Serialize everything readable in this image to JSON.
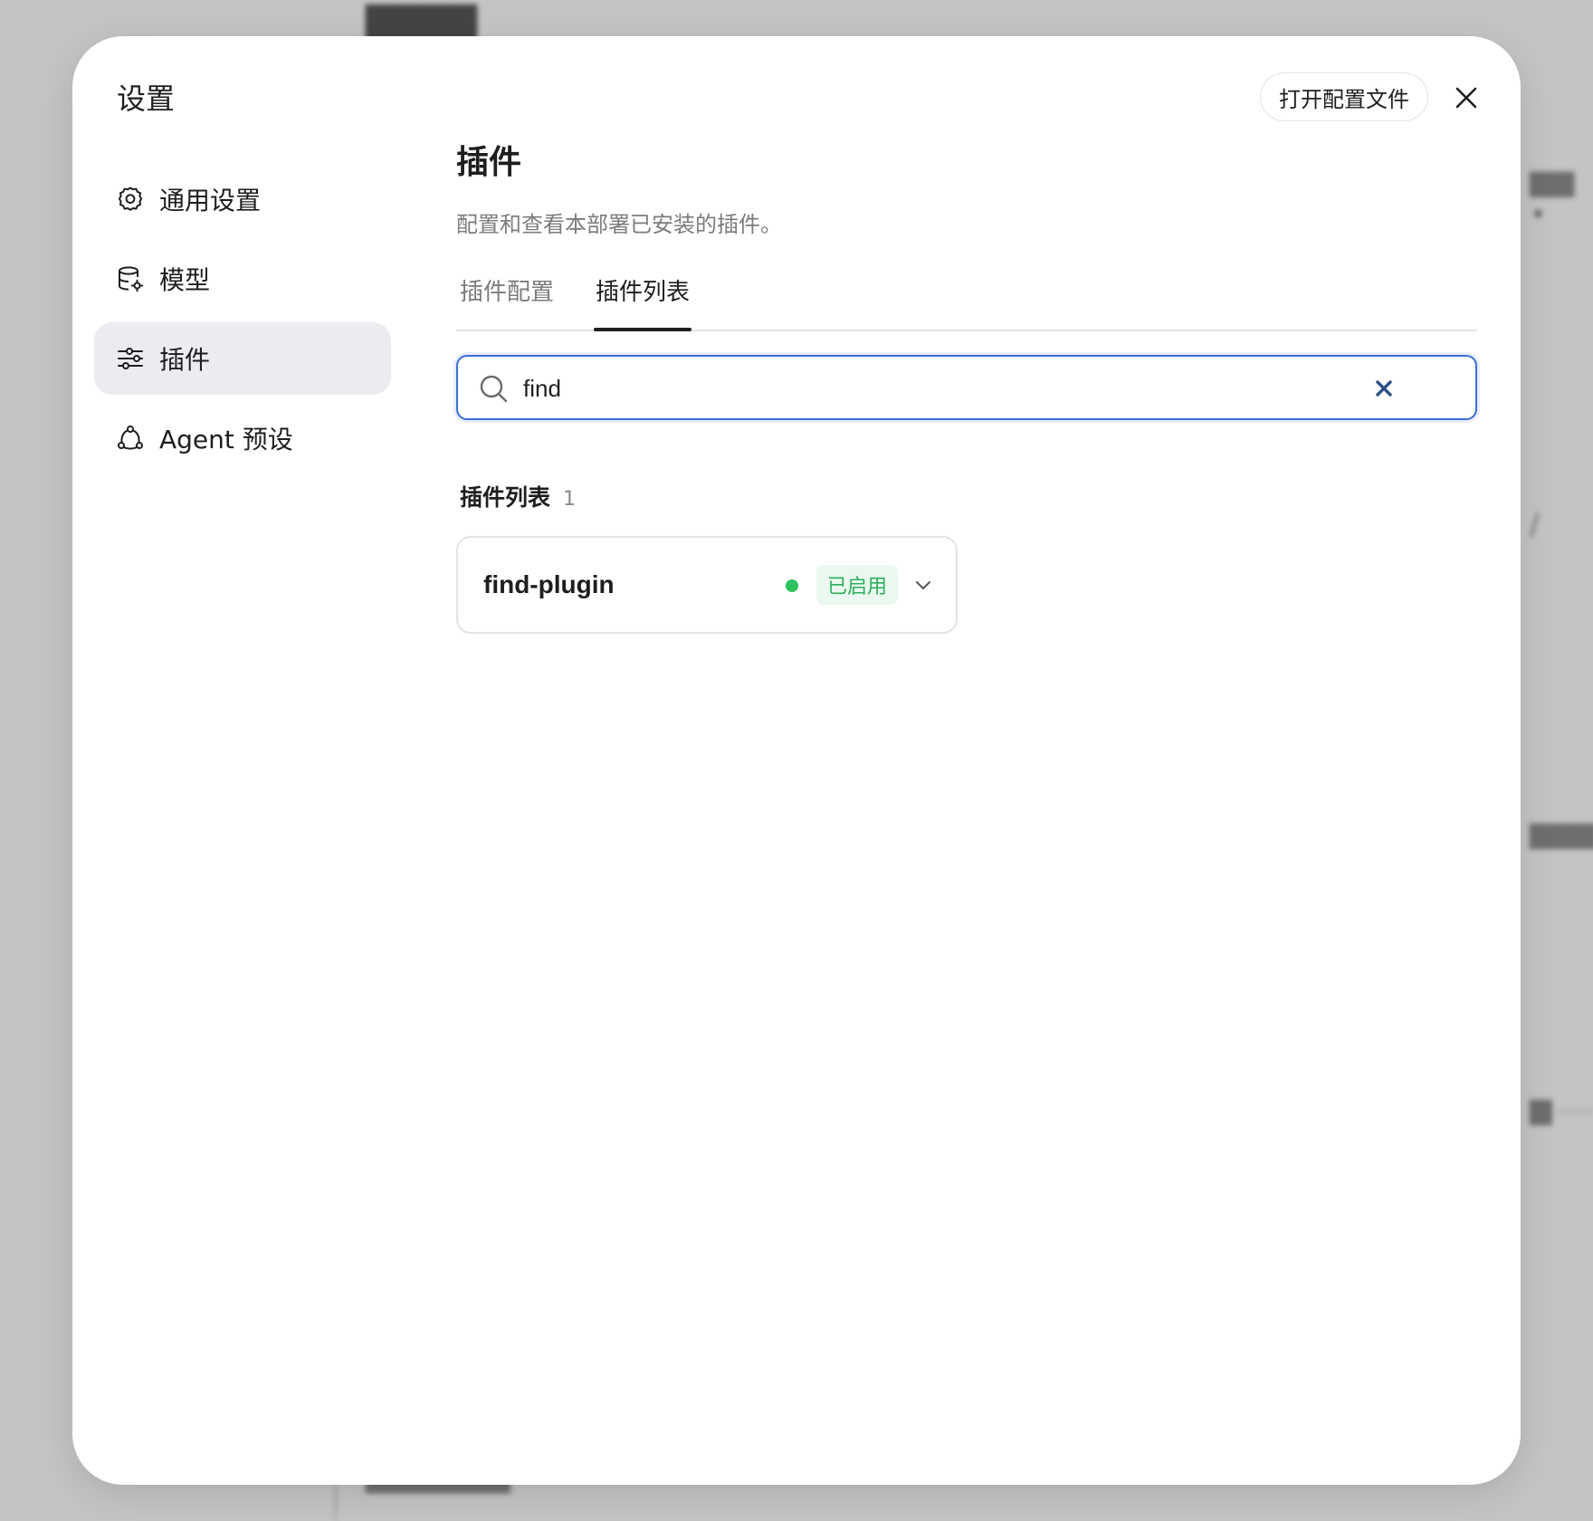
{
  "modal": {
    "title": "设置",
    "open_config_label": "打开配置文件"
  },
  "sidebar": {
    "items": [
      {
        "label": "通用设置",
        "icon": "gear-icon",
        "active": false
      },
      {
        "label": "模型",
        "icon": "database-gear-icon",
        "active": false
      },
      {
        "label": "插件",
        "icon": "sliders-icon",
        "active": true
      },
      {
        "label": "Agent 预设",
        "icon": "agent-network-icon",
        "active": false
      }
    ]
  },
  "main": {
    "title": "插件",
    "description": "配置和查看本部署已安装的插件。",
    "tabs": [
      {
        "label": "插件配置",
        "active": false
      },
      {
        "label": "插件列表",
        "active": true
      }
    ],
    "search": {
      "value": "find",
      "placeholder": ""
    },
    "list": {
      "title": "插件列表",
      "count": "1",
      "plugins": [
        {
          "name": "find-plugin",
          "status": "已启用",
          "status_color": "#2fc15f"
        }
      ]
    }
  },
  "colors": {
    "accent": "#3b6fd4",
    "active_nav_bg": "#eaecf0",
    "enabled_green": "#2fc15f"
  }
}
